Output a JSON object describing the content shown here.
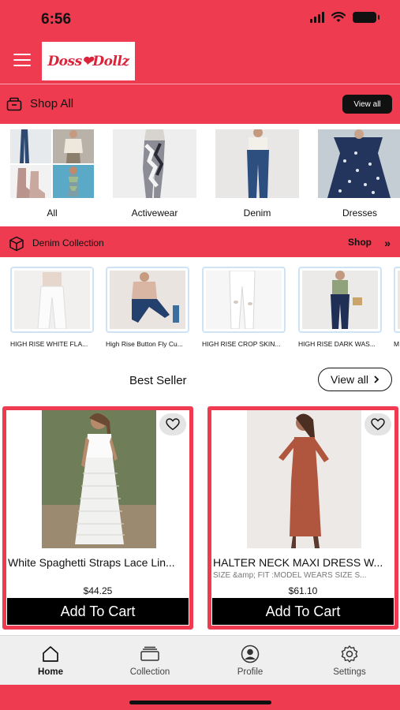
{
  "status_bar": {
    "time": "6:56"
  },
  "header": {
    "logo_text": "Doss❤Dollz"
  },
  "shop_all": {
    "title": "Shop All",
    "view_all_label": "View all"
  },
  "categories": [
    {
      "label": "All"
    },
    {
      "label": "Activewear"
    },
    {
      "label": "Denim"
    },
    {
      "label": "Dresses"
    }
  ],
  "denim_collection": {
    "title": "Denim Collection",
    "shop_label": "Shop",
    "items": [
      {
        "name": "HIGH RISE WHITE FLA..."
      },
      {
        "name": "High Rise Button Fly Cu..."
      },
      {
        "name": "HIGH RISE CROP SKIN..."
      },
      {
        "name": "HIGH RISE DARK WAS..."
      },
      {
        "name": "M"
      }
    ]
  },
  "best_seller": {
    "heading": "Best Seller",
    "view_all_label": "View all",
    "products": [
      {
        "name": "White Spaghetti Straps Lace Lin...",
        "subtitle": "",
        "price": "$44.25",
        "cart_label": "Add To Cart"
      },
      {
        "name": "HALTER NECK MAXI DRESS W...",
        "subtitle": "SIZE &amp; FIT :MODEL WEARS SIZE S...",
        "price": "$61.10",
        "cart_label": "Add To Cart"
      }
    ]
  },
  "tab_bar": {
    "tabs": [
      {
        "label": "Home",
        "icon": "home-icon",
        "active": true
      },
      {
        "label": "Collection",
        "icon": "collection-icon",
        "active": false
      },
      {
        "label": "Profile",
        "icon": "profile-icon",
        "active": false
      },
      {
        "label": "Settings",
        "icon": "settings-icon",
        "active": false
      }
    ]
  },
  "colors": {
    "brand_red": "#ef3b4f",
    "logo_red": "#d9243b",
    "dark": "#111111",
    "card_border": "#cfe3f6"
  }
}
